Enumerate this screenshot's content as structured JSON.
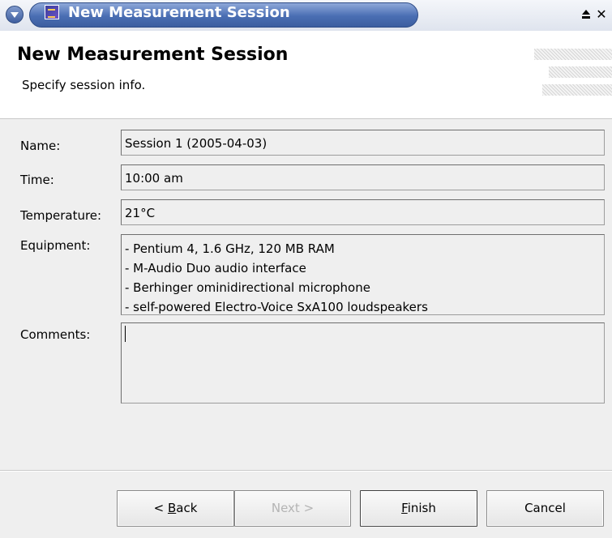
{
  "window": {
    "title": "New Measurement Session"
  },
  "header": {
    "title": "New Measurement Session",
    "description": "Specify session info."
  },
  "form": {
    "name": {
      "label": "Name:",
      "value": "Session 1 (2005-04-03)"
    },
    "time": {
      "label": "Time:",
      "value": "10:00 am"
    },
    "temperature": {
      "label": "Temperature:",
      "value": "21°C"
    },
    "equipment": {
      "label": "Equipment:",
      "lines": [
        "- Pentium 4, 1.6 GHz, 120 MB RAM",
        "- M-Audio Duo audio interface",
        "- Berhinger ominidirectional microphone",
        "- self-powered Electro-Voice SxA100 loudspeakers"
      ]
    },
    "comments": {
      "label": "Comments:",
      "value": ""
    }
  },
  "buttons": {
    "back": {
      "prefix": "< ",
      "mnemonic": "B",
      "rest": "ack",
      "enabled": true
    },
    "next": {
      "label": "Next >",
      "enabled": false
    },
    "finish": {
      "mnemonic": "F",
      "rest": "inish",
      "enabled": true
    },
    "cancel": {
      "label": "Cancel",
      "enabled": true
    }
  },
  "colors": {
    "title_bar": "#4a6eb3",
    "background": "#efefef",
    "header_background": "#ffffff",
    "disabled_text": "#b4b4b4"
  },
  "icons": {
    "window_menu": "chevron-down-icon",
    "app": "app-icon",
    "maximize": "maximize-icon",
    "close": "close-icon"
  }
}
